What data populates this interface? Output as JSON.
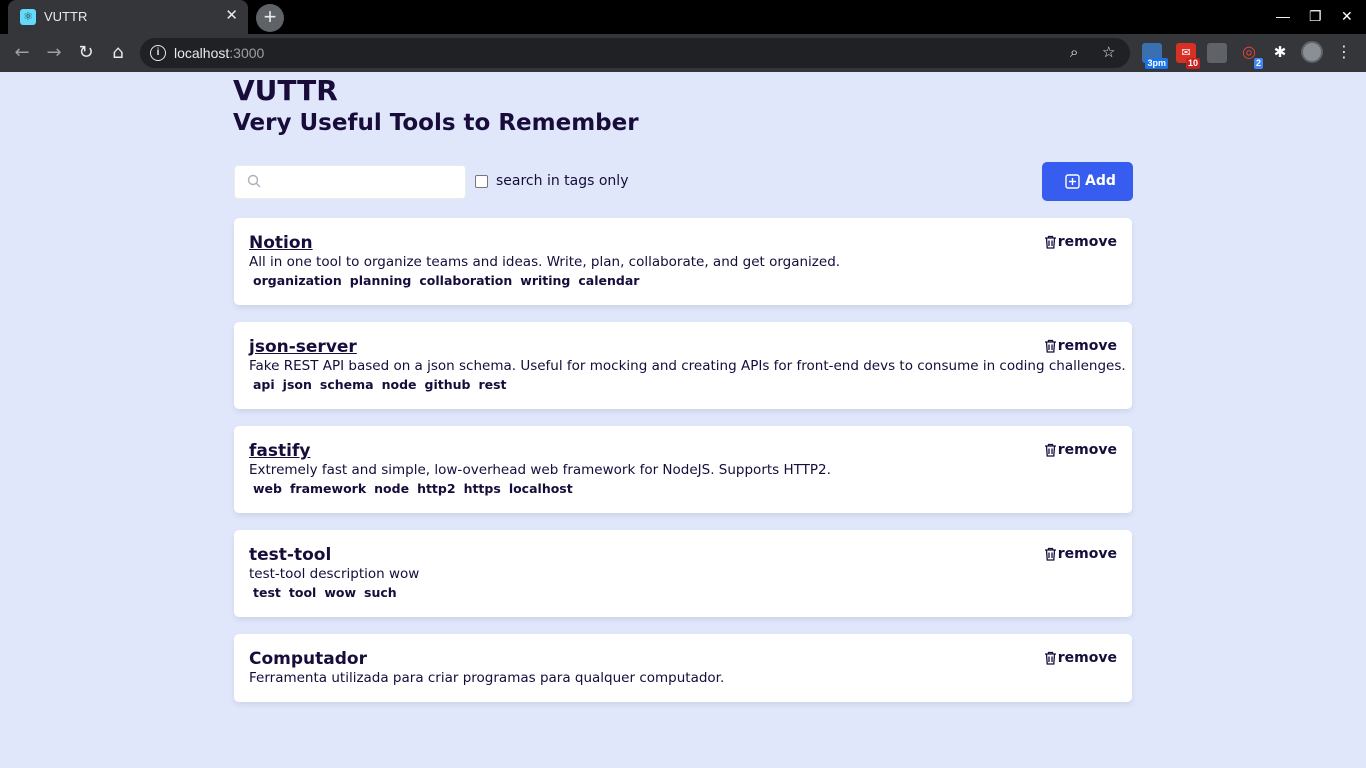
{
  "browser": {
    "tab_title": "VUTTR",
    "tab_close": "✕",
    "new_tab": "+",
    "url_host": "localhost",
    "url_port": ":3000",
    "ext_weather": "3pm",
    "ext_mail_count": "10",
    "ext_other_count": "2"
  },
  "app": {
    "title": "VUTTR",
    "subtitle": "Very Useful Tools to Remember"
  },
  "search": {
    "placeholder": "",
    "value": "",
    "tags_only_label": "search in tags only",
    "tags_only_checked": false
  },
  "add_button": {
    "label": "Add"
  },
  "tools": [
    {
      "title": "Notion",
      "linked": true,
      "description": "All in one tool to organize teams and ideas. Write, plan, collaborate, and get organized.",
      "tags": [
        "organization",
        "planning",
        "collaboration",
        "writing",
        "calendar"
      ],
      "remove_label": "remove"
    },
    {
      "title": "json-server",
      "linked": true,
      "description": "Fake REST API based on a json schema. Useful for mocking and creating APIs for front-end devs to consume in coding challenges.",
      "tags": [
        "api",
        "json",
        "schema",
        "node",
        "github",
        "rest"
      ],
      "remove_label": "remove"
    },
    {
      "title": "fastify",
      "linked": true,
      "description": "Extremely fast and simple, low-overhead web framework for NodeJS. Supports HTTP2.",
      "tags": [
        "web",
        "framework",
        "node",
        "http2",
        "https",
        "localhost"
      ],
      "remove_label": "remove"
    },
    {
      "title": "test-tool",
      "linked": false,
      "description": "test-tool description wow",
      "tags": [
        "test",
        "tool",
        "wow",
        "such"
      ],
      "remove_label": "remove"
    },
    {
      "title": "Computador",
      "linked": false,
      "description": "Ferramenta utilizada para criar programas para qualquer computador.",
      "tags": [],
      "remove_label": "remove"
    }
  ],
  "colors": {
    "background": "#e1e7fb",
    "text": "#170c3a",
    "primary": "#365df0"
  }
}
